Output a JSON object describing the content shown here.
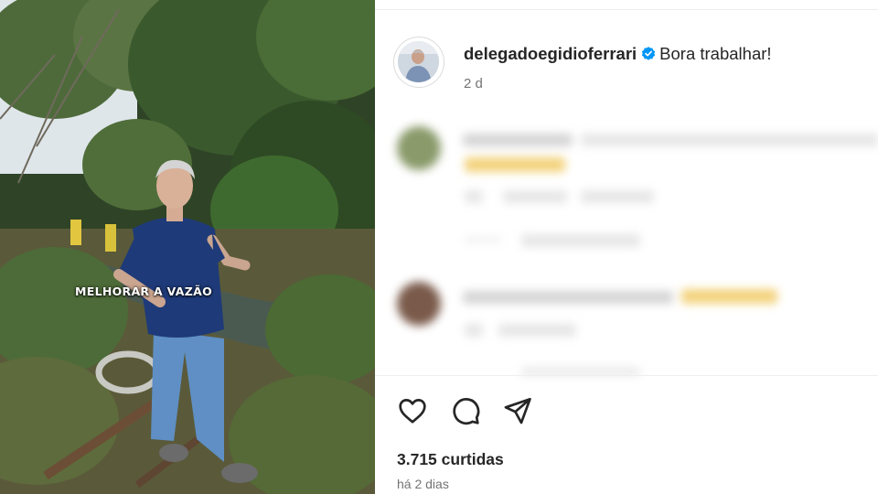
{
  "media": {
    "overlay_caption": "MELHORAR A VAZÃO"
  },
  "post": {
    "username": "delegadoegidioferrari",
    "verified": true,
    "caption": "Bora trabalhar!",
    "time_ago": "2 d"
  },
  "comments_region": {
    "state": "blurred",
    "count_visible": 2
  },
  "actions": {
    "like_icon": "heart-icon",
    "comment_icon": "comment-bubble-icon",
    "share_icon": "paper-plane-icon"
  },
  "stats": {
    "likes_text": "3.715 curtidas",
    "date_text": "há 2 dias"
  },
  "colors": {
    "verified_blue": "#0095f6",
    "text_primary": "#262626",
    "text_secondary": "#737373",
    "shirt_navy": "#1e3a78",
    "jeans_blue": "#5f8fc4"
  }
}
